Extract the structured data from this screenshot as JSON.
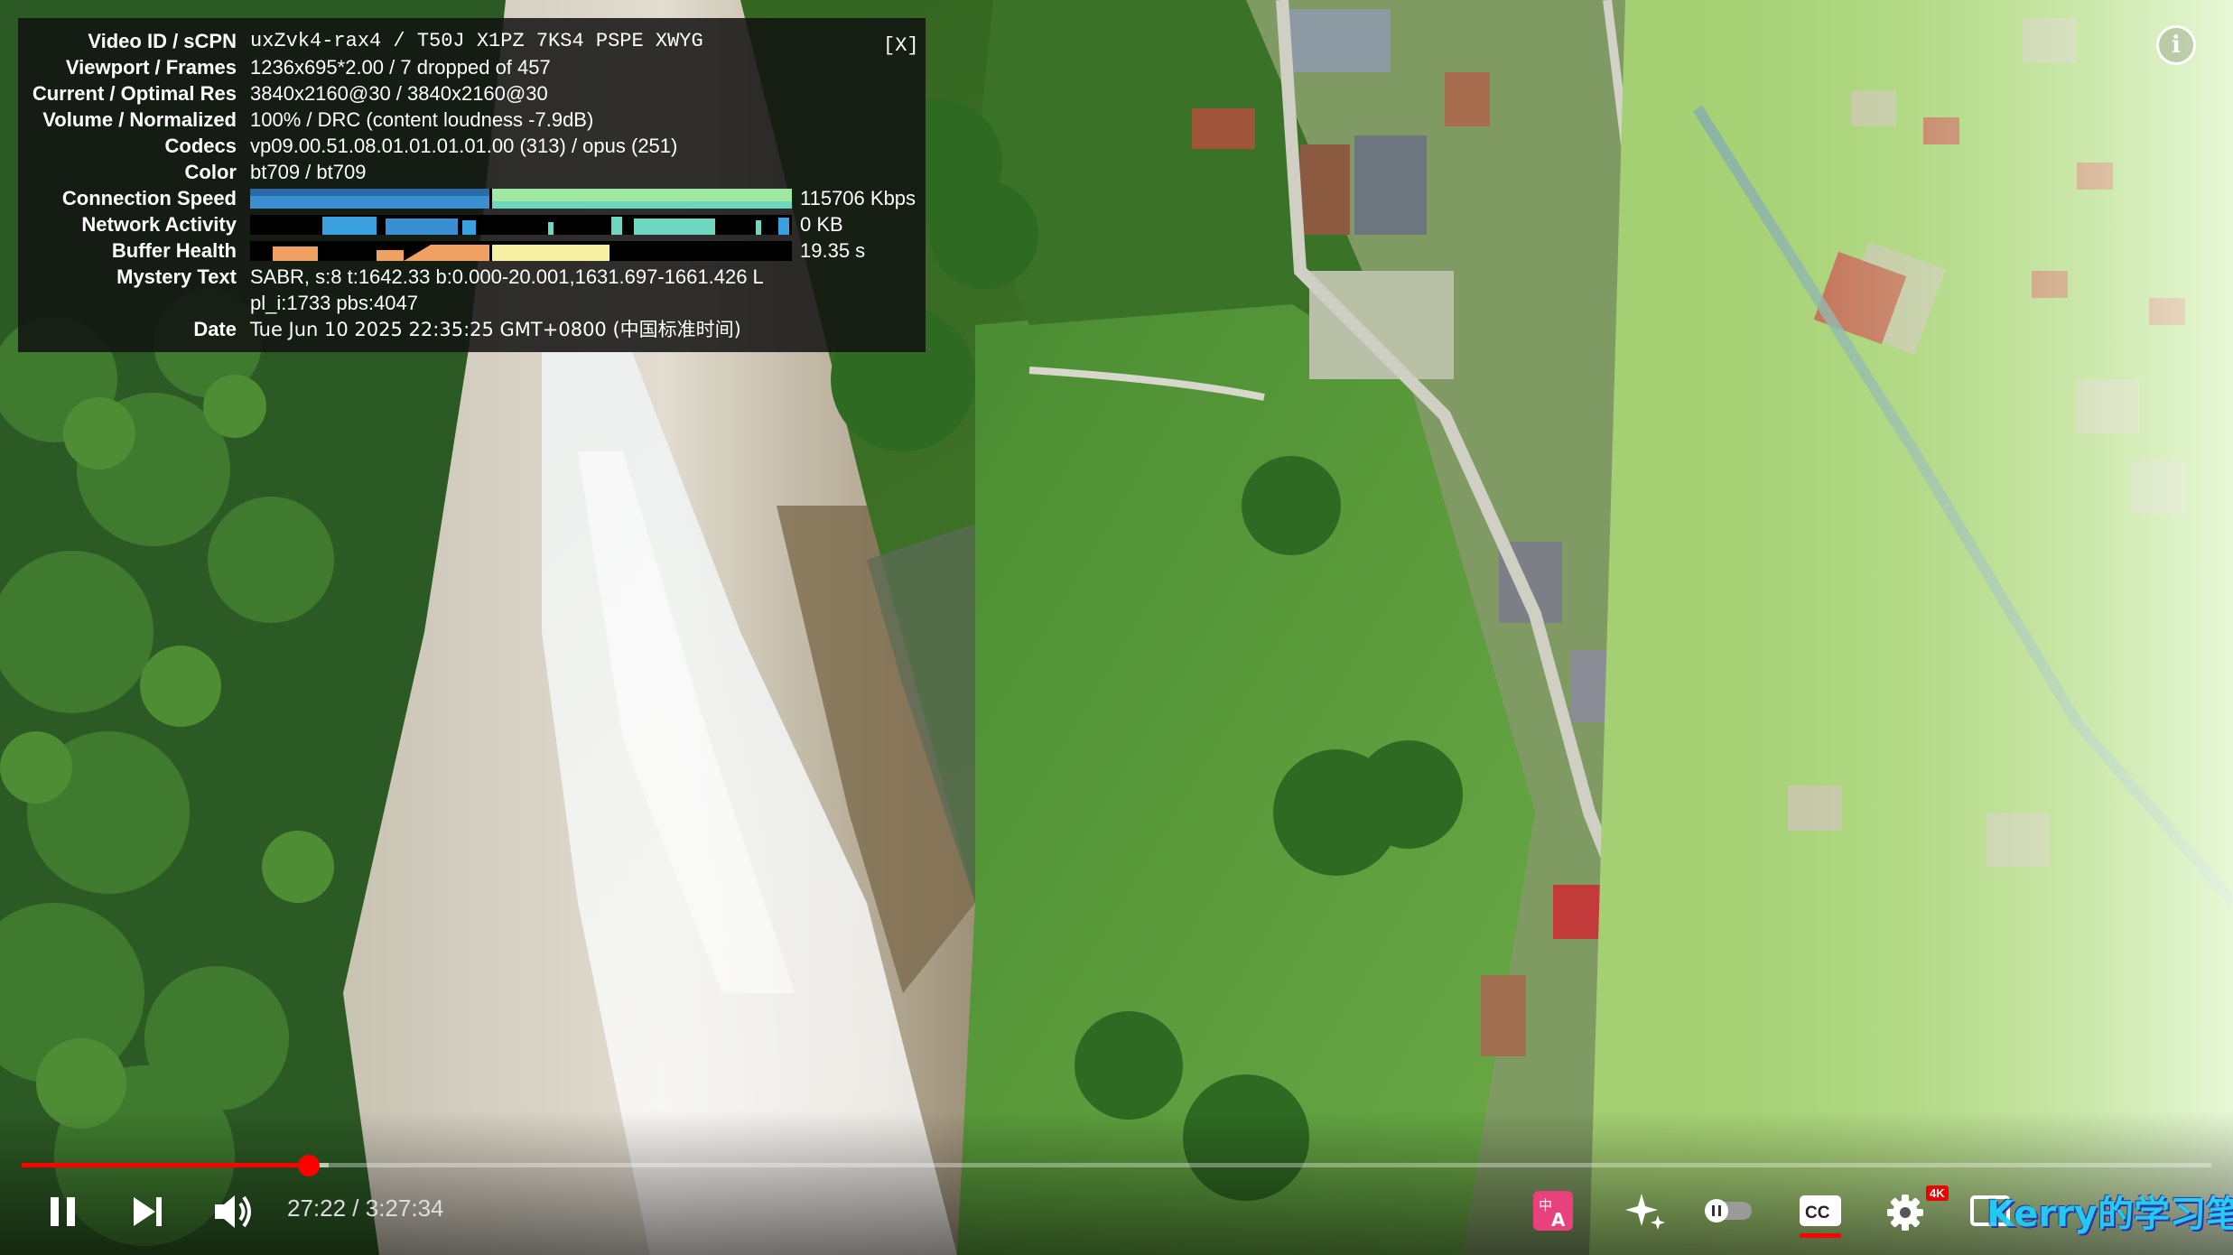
{
  "stats": {
    "close_label": "[X]",
    "rows": [
      {
        "label": "Video ID / sCPN",
        "value": "uxZvk4-rax4 / T50J X1PZ 7KS4 PSPE XWYG"
      },
      {
        "label": "Viewport / Frames",
        "value": "1236x695*2.00 / 7 dropped of 457"
      },
      {
        "label": "Current / Optimal Res",
        "value": "3840x2160@30 / 3840x2160@30"
      },
      {
        "label": "Volume / Normalized",
        "value": "100% / DRC (content loudness -7.9dB)"
      },
      {
        "label": "Codecs",
        "value": "vp09.00.51.08.01.01.01.01.00 (313) / opus (251)"
      },
      {
        "label": "Color",
        "value": "bt709 / bt709"
      },
      {
        "label": "Connection Speed",
        "value": "115706 Kbps"
      },
      {
        "label": "Network Activity",
        "value": "0 KB"
      },
      {
        "label": "Buffer Health",
        "value": "19.35 s"
      },
      {
        "label": "Mystery Text",
        "value": "SABR, s:8 t:1642.33 b:0.000-20.001,1631.697-1661.426 L",
        "value2": "pl_i:1733 pbs:4047"
      },
      {
        "label": "Date",
        "value": "Tue Jun 10 2025 22:35:25 GMT+0800 (中国标准时间)"
      }
    ],
    "colors": {
      "connection_a": "#3a8fd0",
      "connection_b": "#9fe8a0",
      "network": "#3aa0e0",
      "network_b": "#6fd6c0",
      "buffer": "#f0a060",
      "buffer_b": "#f7f0a0"
    }
  },
  "player": {
    "time_current": "27:22",
    "time_separator": " / ",
    "time_total": "3:27:34",
    "progress_fraction": 0.131,
    "info_icon": "i",
    "quality_badge": "4K",
    "watermark_text": "Kerry的学习笔记",
    "icons": [
      "pause-icon",
      "next-icon",
      "volume-icon",
      "translate-icon",
      "sparkle-icon",
      "autoplay-toggle-icon",
      "subtitles-icon",
      "settings-icon",
      "miniplayer-icon"
    ],
    "colors": {
      "progress": "#ff0000",
      "translate_bg": "#e8417c"
    }
  }
}
